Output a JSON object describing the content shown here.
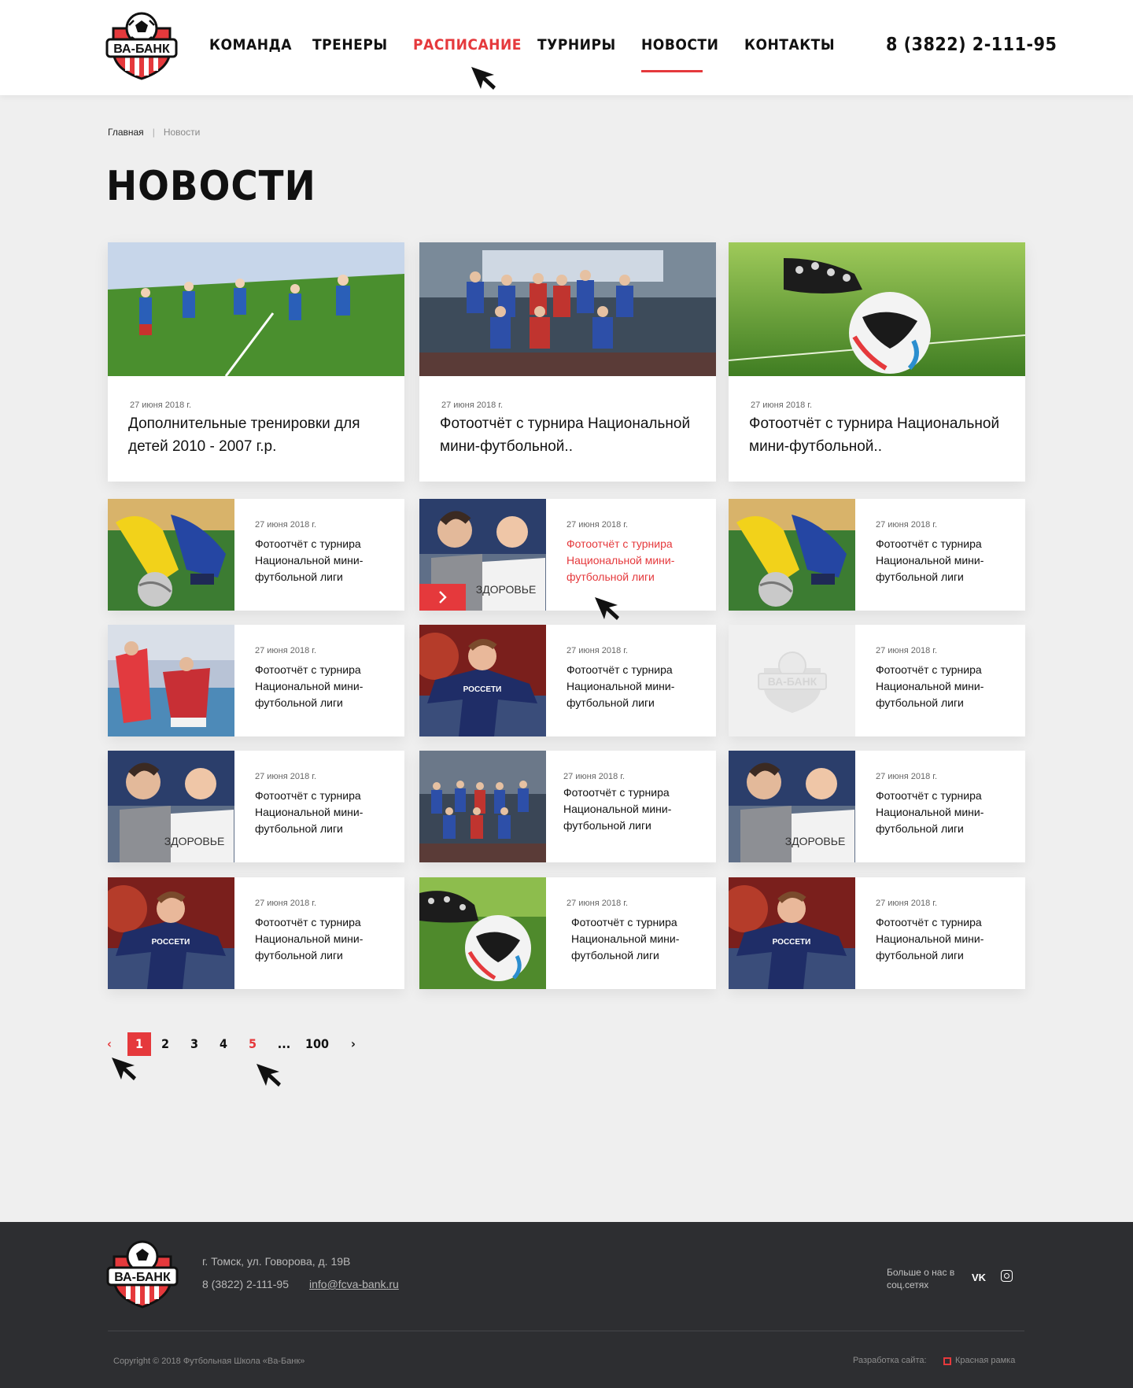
{
  "header": {
    "logo_text": "ВА-БАНК",
    "nav": [
      "КОМАНДА",
      "ТРЕНЕРЫ",
      "РАСПИСАНИЕ",
      "ТУРНИРЫ",
      "НОВОСТИ",
      "КОНТАКТЫ"
    ],
    "phone": "8 (3822) 2-111-95"
  },
  "breadcrumb": {
    "home": "Главная",
    "current": "Новости"
  },
  "page_title": "НОВОСТИ",
  "big_cards": [
    {
      "date": "27 июня 2018 г.",
      "title": "Дополнительные тренировки для детей 2010 - 2007 г.р."
    },
    {
      "date": "27 июня 2018 г.",
      "title": "Фотоотчёт с турнира Национальной мини-футбольной.."
    },
    {
      "date": "27 июня 2018 г.",
      "title": "Фотоотчёт с турнира Национальной мини-футбольной.."
    }
  ],
  "small_cards": [
    {
      "date": "27 июня 2018 г.",
      "title": "Фотоотчёт с турнира Национальной мини-футбольной лиги",
      "image": "soccer-tackle"
    },
    {
      "date": "27 июня 2018 г.",
      "title": "Фотоотчёт с турнира Национальной мини-футбольной лиги",
      "image": "players-shirt"
    },
    {
      "date": "27 июня 2018 г.",
      "title": "Фотоотчёт с турнира Национальной мини-футбольной лиги",
      "image": "soccer-tackle"
    },
    {
      "date": "27 июня 2018 г.",
      "title": "Фотоотчёт с турнира Национальной мини-футбольной лиги",
      "image": "match-action"
    },
    {
      "date": "27 июня 2018 г.",
      "title": "Фотоотчёт с турнира Национальной мини-футбольной лиги",
      "image": "player-celebrating"
    },
    {
      "date": "27 июня 2018 г.",
      "title": "Фотоотчёт с турнира Национальной мини-футбольной лиги",
      "image": "logo-placeholder"
    },
    {
      "date": "27 июня 2018 г.",
      "title": "Фотоотчёт с турнира Национальной мини-футбольной лиги",
      "image": "players-shirt"
    },
    {
      "date": "27 июня 2018 г.",
      "title": "Фотоотчёт с турнира Национальной мини-футбольной лиги",
      "image": "team-photo"
    },
    {
      "date": "27 июня 2018 г.",
      "title": "Фотоотчёт с турнира Национальной мини-футбольной лиги",
      "image": "players-shirt"
    },
    {
      "date": "27 июня 2018 г.",
      "title": "Фотоотчёт с турнира Национальной мини-футбольной лиги",
      "image": "player-celebrating"
    },
    {
      "date": "27 июня 2018 г.",
      "title": "Фотоотчёт с турнира Национальной мини-футбольной лиги",
      "image": "ball-boot"
    },
    {
      "date": "27 июня 2018 г.",
      "title": "Фотоотчёт с турнира Национальной мини-футбольной лиги",
      "image": "player-celebrating"
    }
  ],
  "pagination": {
    "prev": "‹",
    "pages": [
      "1",
      "2",
      "3",
      "4",
      "5"
    ],
    "ellipsis": "...",
    "last": "100",
    "next": "›",
    "active": "1"
  },
  "footer": {
    "logo_text": "ВА-БАНК",
    "address": "г. Томск, ул. Говорова, д. 19В",
    "phone": "8 (3822) 2-111-95",
    "email": "info@fcva-bank.ru",
    "social_label": "Больше о нас в соц.сетях",
    "vk": "VK",
    "copyright": "Copyright © 2018 Футбольная Школа «Ва-Банк»",
    "dev_label": "Разработка сайта:",
    "dev_name": "Красная рамка"
  },
  "colors": {
    "accent": "#e5393c",
    "footer_bg": "#2d2e31",
    "page_bg": "#efefef"
  }
}
